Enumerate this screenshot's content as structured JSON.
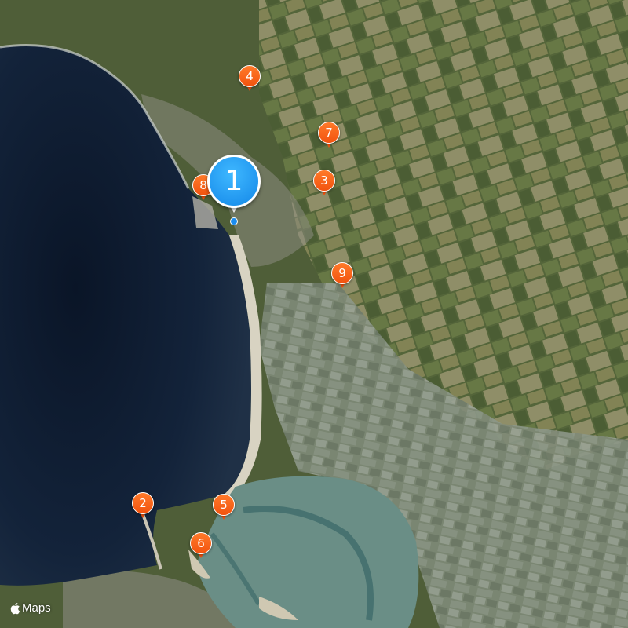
{
  "attribution": {
    "logo_icon": "apple-logo-icon",
    "text": "Maps"
  },
  "main_pin": {
    "label": "1",
    "color": "#1a8cf0",
    "icon": "location-pin-icon"
  },
  "pins": [
    {
      "id": "pin-2",
      "label": "2"
    },
    {
      "id": "pin-3",
      "label": "3"
    },
    {
      "id": "pin-4",
      "label": "4"
    },
    {
      "id": "pin-5",
      "label": "5"
    },
    {
      "id": "pin-6",
      "label": "6"
    },
    {
      "id": "pin-7",
      "label": "7"
    },
    {
      "id": "pin-8",
      "label": "8"
    },
    {
      "id": "pin-9",
      "label": "9"
    }
  ],
  "colors": {
    "pin": "#f2530f",
    "sea": "#0f1e33",
    "land": "#4f5e38",
    "beach": "#d8d3c2",
    "tidal_flat": "#6a8e86"
  }
}
